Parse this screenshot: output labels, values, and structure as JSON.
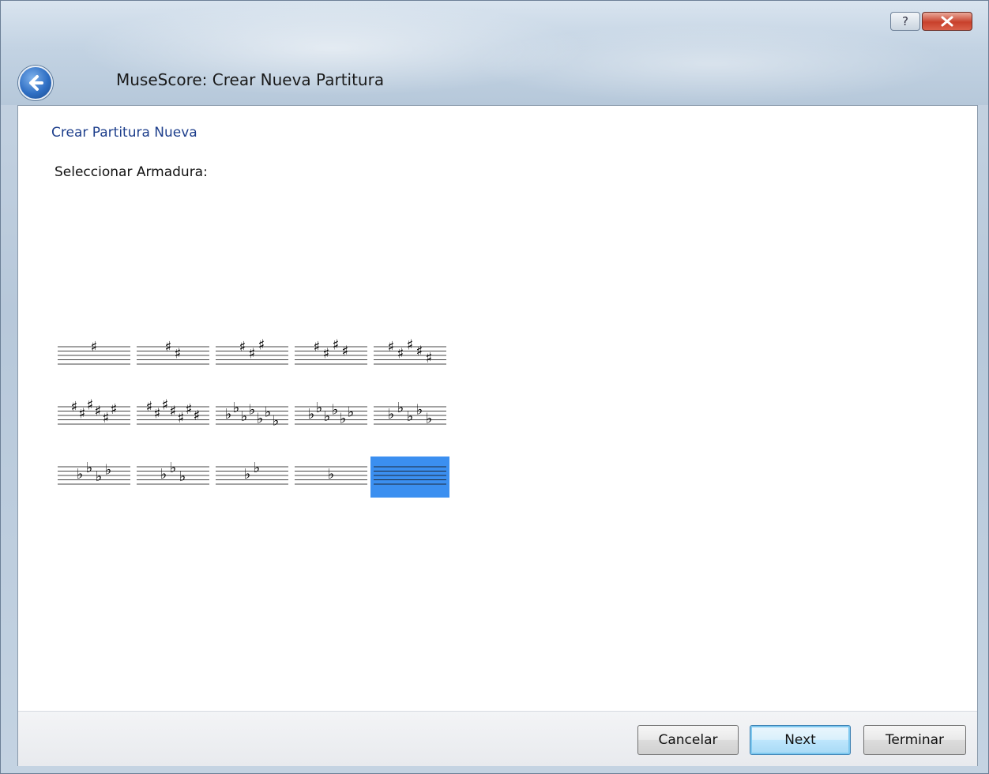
{
  "window": {
    "title": "MuseScore: Crear Nueva Partitura",
    "help_glyph": "?",
    "icons": {
      "back": "back-arrow-icon",
      "help": "help-icon",
      "close": "close-icon"
    }
  },
  "page": {
    "heading": "Crear Partitura Nueva",
    "prompt": "Seleccionar Armadura:"
  },
  "key_signatures": [
    {
      "type": "sharp",
      "count": 1
    },
    {
      "type": "sharp",
      "count": 2
    },
    {
      "type": "sharp",
      "count": 3
    },
    {
      "type": "sharp",
      "count": 4
    },
    {
      "type": "sharp",
      "count": 5
    },
    {
      "type": "sharp",
      "count": 6
    },
    {
      "type": "sharp",
      "count": 7
    },
    {
      "type": "flat",
      "count": 7
    },
    {
      "type": "flat",
      "count": 6
    },
    {
      "type": "flat",
      "count": 5
    },
    {
      "type": "flat",
      "count": 4
    },
    {
      "type": "flat",
      "count": 3
    },
    {
      "type": "flat",
      "count": 2
    },
    {
      "type": "flat",
      "count": 1
    },
    {
      "type": "none",
      "count": 0,
      "selected": true
    }
  ],
  "colors": {
    "selected": "#3b8ff0",
    "heading": "#1e3f8c"
  },
  "buttons": {
    "cancel": "Cancelar",
    "next": "Next",
    "finish": "Terminar"
  }
}
